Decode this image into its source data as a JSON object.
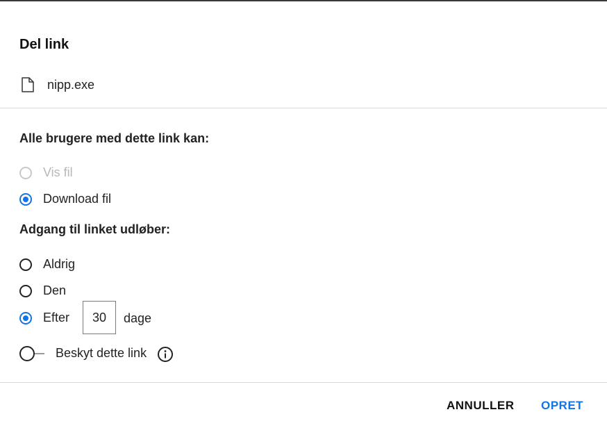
{
  "dialog": {
    "title": "Del link",
    "file": {
      "name": "nipp.exe",
      "icon": "file-icon"
    },
    "permissions": {
      "label": "Alle brugere med dette link kan:",
      "options": [
        {
          "label": "Vis fil",
          "checked": false,
          "disabled": true
        },
        {
          "label": "Download fil",
          "checked": true,
          "disabled": false
        }
      ]
    },
    "expiry": {
      "label": "Adgang til linket udløber:",
      "options": [
        {
          "label": "Aldrig",
          "checked": false
        },
        {
          "label": "Den",
          "checked": false
        },
        {
          "label": "Efter",
          "checked": true
        }
      ],
      "days_value": "30",
      "days_unit": "dage"
    },
    "protect": {
      "label": "Beskyt dette link",
      "enabled": false,
      "info_icon": "info-icon"
    },
    "buttons": {
      "cancel": "ANNULLER",
      "create": "OPRET"
    },
    "accent_color": "#1473e6"
  }
}
